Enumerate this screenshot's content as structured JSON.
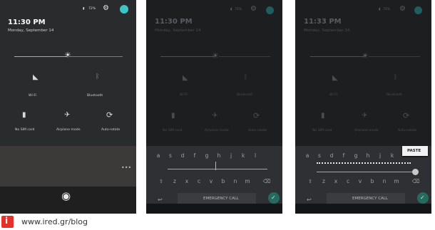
{
  "panels": [
    {
      "status": {
        "battery": "72%"
      },
      "time": "11:30 PM",
      "date": "Monday, September 14",
      "tiles": {
        "wifi": "Wi-Fi",
        "bluetooth": "Bluetooth",
        "sim": "No SIM card",
        "airplane": "Airplane mode",
        "autorotate": "Auto-rotate"
      }
    },
    {
      "status": {
        "battery": "72%"
      },
      "time": "11:30 PM",
      "date": "Monday, September 14",
      "tiles": {
        "wifi": "Wi-Fi",
        "bluetooth": "Bluetooth",
        "sim": "No SIM card",
        "airplane": "Airplane mode",
        "autorotate": "Auto-rotate"
      },
      "emergency": "EMERGENCY CALL"
    },
    {
      "status": {
        "battery": "72%"
      },
      "time": "11:33 PM",
      "date": "Monday, September 14",
      "tiles": {
        "wifi": "Wi-Fi",
        "bluetooth": "Bluetooth",
        "sim": "No SIM card",
        "airplane": "Airplane mode",
        "autorotate": "Auto-rotate"
      },
      "paste": "PASTE",
      "emergency": "EMERGENCY CALL"
    }
  ],
  "keyboard": {
    "row1": [
      "a",
      "s",
      "d",
      "f",
      "g",
      "h",
      "j",
      "k",
      "l"
    ],
    "row2": [
      "z",
      "x",
      "c",
      "v",
      "b",
      "n",
      "m"
    ]
  },
  "watermark": {
    "text": "www.ired.gr/blog",
    "logo_letter": "i",
    "brand_color": "#e5312b"
  }
}
